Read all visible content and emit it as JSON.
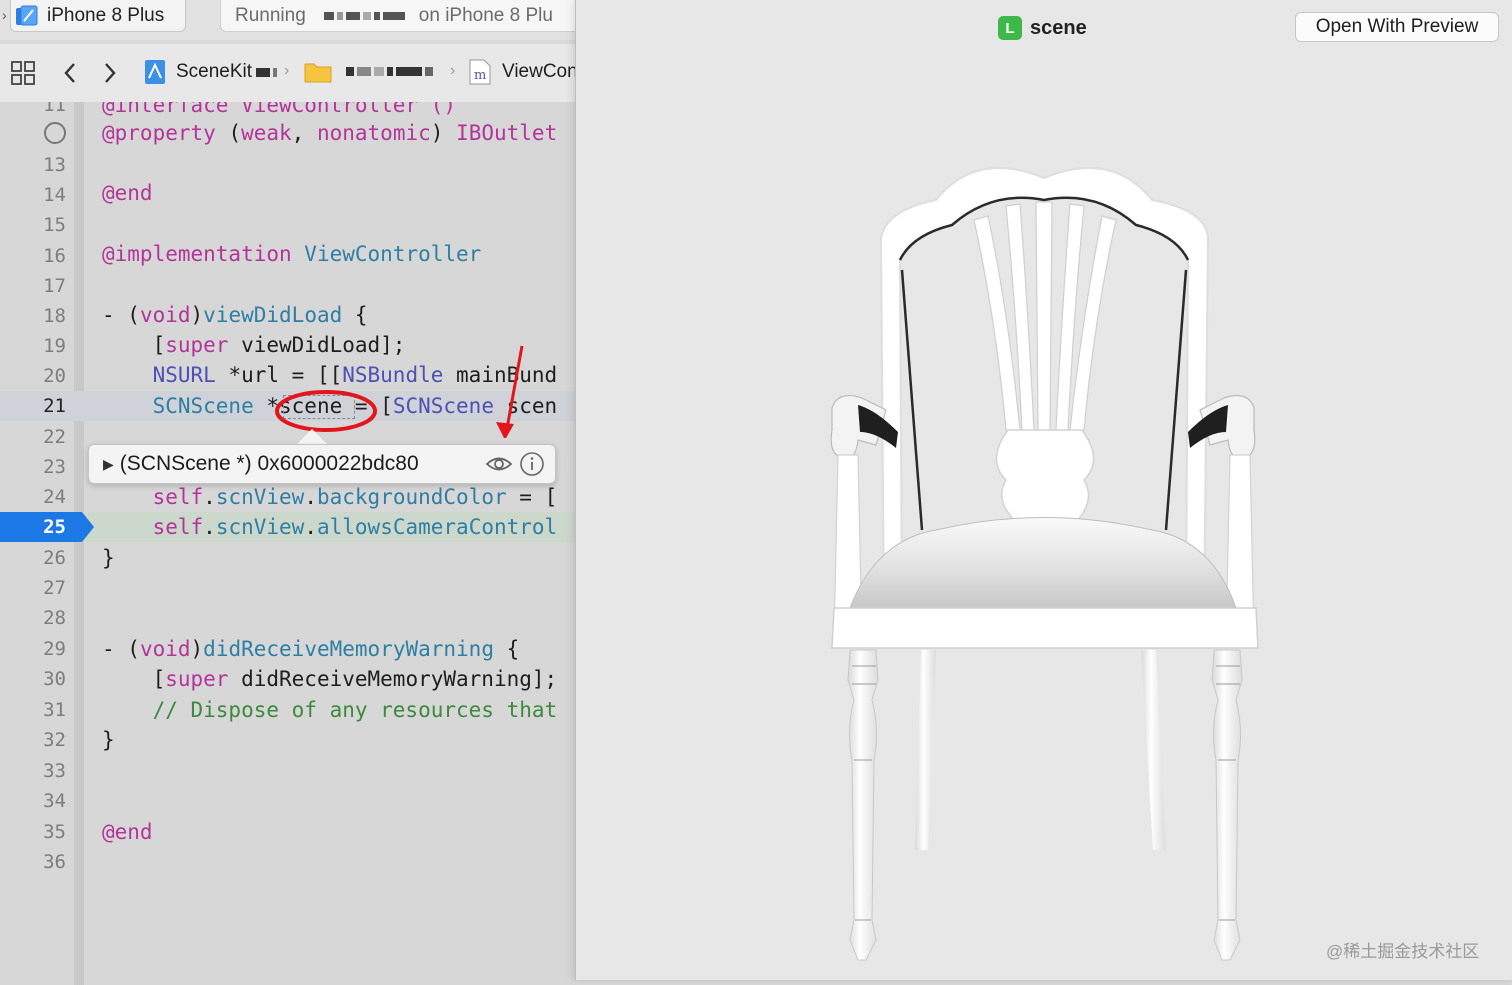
{
  "toolbar": {
    "scheme_label": "iPhone 8 Plus",
    "status_prefix": "Running",
    "status_suffix": "on iPhone 8 Plu"
  },
  "jumpbar": {
    "project_label": "SceneKit",
    "file_label": "ViewCon",
    "file_icon_letter": "m"
  },
  "editor": {
    "line_numbers": [
      "11",
      "13",
      "14",
      "15",
      "16",
      "17",
      "18",
      "19",
      "20",
      "21",
      "22",
      "23",
      "24",
      "25",
      "26",
      "27",
      "28",
      "29",
      "30",
      "31",
      "32",
      "33",
      "34",
      "35",
      "36"
    ],
    "current_line": "25",
    "lines": {
      "l11": "@interface ViewController ()",
      "l12_a": "@property",
      "l12_b": " (",
      "l12_c": "weak",
      "l12_d": ", ",
      "l12_e": "nonatomic",
      "l12_f": ") ",
      "l12_g": "IBOutlet",
      "l14": "@end",
      "l16_a": "@implementation",
      "l16_b": " ViewController",
      "l18_a": "- (",
      "l18_b": "void",
      "l18_c": ")",
      "l18_d": "viewDidLoad",
      "l18_e": " {",
      "l19_a": "    [",
      "l19_b": "super",
      "l19_c": " viewDidLoad];",
      "l20_a": "    ",
      "l20_b": "NSURL",
      "l20_c": " *url = [[",
      "l20_d": "NSBundle",
      "l20_e": " mainBund",
      "l21_a": "    ",
      "l21_b": "SCNScene",
      "l21_c": " *scene = [",
      "l21_d": "SCNScene",
      "l21_e": " scen",
      "l24_a": "    ",
      "l24_b": "self",
      "l24_c": ".",
      "l24_d": "scnView",
      "l24_e": ".",
      "l24_f": "backgroundColor",
      "l24_g": " = [",
      "l25_a": "    ",
      "l25_b": "self",
      "l25_c": ".",
      "l25_d": "scnView",
      "l25_e": ".",
      "l25_f": "allowsCameraControl",
      "l26": "}",
      "l29_a": "- (",
      "l29_b": "void",
      "l29_c": ")",
      "l29_d": "didReceiveMemoryWarning",
      "l29_e": " {",
      "l30_a": "    [",
      "l30_b": "super",
      "l30_c": " didReceiveMemoryWarning];",
      "l31": "    // Dispose of any resources that",
      "l32": "}",
      "l35": "@end"
    }
  },
  "datatip": {
    "value": "(SCNScene *) 0x6000022bdc80"
  },
  "quicklook": {
    "title": "scene",
    "badge_letter": "L",
    "open_button": "Open With Preview",
    "watermark": "@稀土掘金技术社区"
  },
  "colors": {
    "keyword": "#b3359a",
    "type": "#4c51b3",
    "function": "#2f7ea3",
    "comment": "#3c8a3c",
    "breakpoint_blue": "#1b78e5",
    "annotation_red": "#e4161d"
  }
}
